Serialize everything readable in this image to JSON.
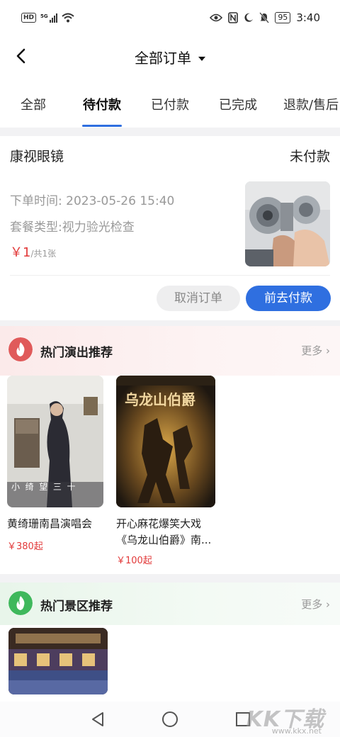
{
  "status_bar": {
    "hd": "HD",
    "signal": "5G",
    "time": "3:40",
    "battery": "95"
  },
  "header": {
    "title": "全部订单"
  },
  "tabs": [
    {
      "label": "全部"
    },
    {
      "label": "待付款",
      "active": true
    },
    {
      "label": "已付款"
    },
    {
      "label": "已完成"
    },
    {
      "label": "退款/售后"
    }
  ],
  "order": {
    "shop": "康视眼镜",
    "status": "未付款",
    "time": "下单时间: 2023-05-26 15:40",
    "package": "套餐类型:视力验光检查",
    "price": "￥1",
    "count": "/共1张",
    "cancel_label": "取消订单",
    "pay_label": "前去付款"
  },
  "shows": {
    "title": "热门演出推荐",
    "more": "更多",
    "items": [
      {
        "name": "黄绮珊南昌演唱会",
        "price": "￥380起",
        "poster_text": "小  绮  望  三  十"
      },
      {
        "name_line1": "开心麻花爆笑大戏",
        "name_line2": "《乌龙山伯爵》南...",
        "price": "￥100起",
        "poster_text": "乌龙山伯爵"
      }
    ]
  },
  "scenic": {
    "title": "热门景区推荐",
    "more": "更多"
  },
  "watermark": {
    "brand": "KK下载",
    "url": "www.kkx.net"
  },
  "colors": {
    "accent": "#2f6fe0",
    "price": "#e23a3a",
    "show_icon": "#e05a5a",
    "scenic_icon": "#3fb85c"
  }
}
